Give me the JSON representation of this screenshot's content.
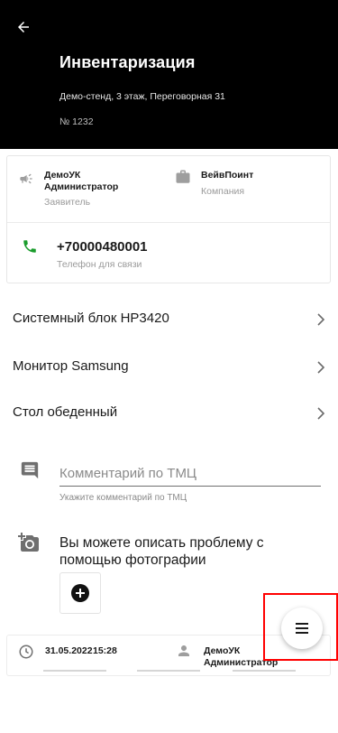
{
  "header": {
    "title": "Инвентаризация",
    "address": "Демо-стенд, 3 этаж, Переговорная 31",
    "number": "№ 1232"
  },
  "info_card": {
    "applicant_name": "ДемоУК",
    "applicant_role": "Администратор",
    "applicant_caption": "Заявитель",
    "company_name": "ВейвПоинт",
    "company_caption": "Компания",
    "phone": "+70000480001",
    "phone_caption": "Телефон для связи"
  },
  "items": [
    {
      "label": "Системный блок HP3420"
    },
    {
      "label": "Монитор Samsung"
    },
    {
      "label": "Стол обеденный"
    }
  ],
  "comment": {
    "placeholder": "Комментарий по ТМЦ",
    "hint": "Укажите комментарий по ТМЦ"
  },
  "photo": {
    "text": "Вы можете описать проблему с помощью фотографии"
  },
  "history": {
    "date": "31.05.2022",
    "time": "15:28",
    "user_name": "ДемоУК",
    "user_role": "Администратор"
  },
  "colors": {
    "header_bg": "#000000",
    "phone_icon": "#1a9c2c",
    "highlight": "#ff0000"
  },
  "icons": {
    "back": "arrow-left-icon",
    "applicant": "megaphone-icon",
    "company": "briefcase-icon",
    "phone": "phone-icon",
    "chevron": "chevron-right-icon",
    "comment": "comment-icon",
    "camera": "add-photo-icon",
    "plus": "plus-icon",
    "clock": "clock-icon",
    "person": "person-icon",
    "menu": "menu-icon"
  }
}
